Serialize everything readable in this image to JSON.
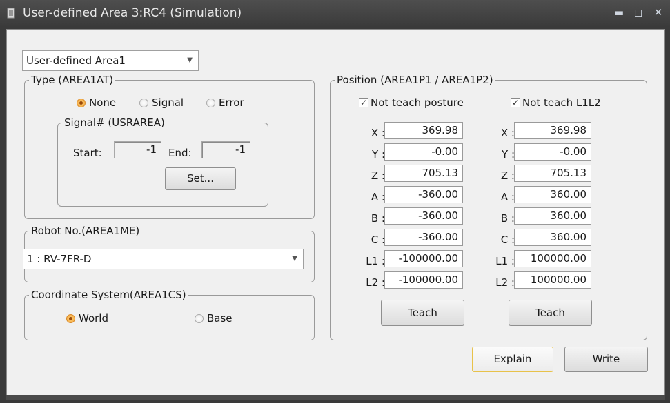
{
  "window": {
    "title": "User-defined Area 3:RC4  (Simulation)",
    "controls": {
      "minimize": "▬",
      "maximize": "◻",
      "close": "✕"
    }
  },
  "area_select": {
    "value": "User-defined Area1"
  },
  "type_group": {
    "legend": "Type (AREA1AT)",
    "options": [
      {
        "label": "None",
        "selected": true
      },
      {
        "label": "Signal",
        "selected": false
      },
      {
        "label": "Error",
        "selected": false
      }
    ]
  },
  "signal_group": {
    "legend": "Signal# (USRAREA)",
    "start_label": "Start:",
    "start_value": "-1",
    "end_label": "End:",
    "end_value": "-1",
    "set_button": "Set..."
  },
  "robot_group": {
    "legend": "Robot No.(AREA1ME)",
    "value": "1 : RV-7FR-D"
  },
  "coord_group": {
    "legend": "Coordinate System(AREA1CS)",
    "options": [
      {
        "label": "World",
        "selected": true
      },
      {
        "label": "Base",
        "selected": false
      }
    ]
  },
  "position_group": {
    "legend": "Position (AREA1P1 / AREA1P2)",
    "check_posture": {
      "label": "Not teach posture",
      "checked": true
    },
    "check_l1l2": {
      "label": "Not teach L1L2",
      "checked": true
    },
    "p1": {
      "rows": [
        {
          "label": "X :",
          "value": "369.98"
        },
        {
          "label": "Y :",
          "value": "-0.00"
        },
        {
          "label": "Z :",
          "value": "705.13"
        },
        {
          "label": "A :",
          "value": "-360.00"
        },
        {
          "label": "B :",
          "value": "-360.00"
        },
        {
          "label": "C :",
          "value": "-360.00"
        },
        {
          "label": "L1 :",
          "value": "-100000.00"
        },
        {
          "label": "L2 :",
          "value": "-100000.00"
        }
      ],
      "teach_button": "Teach"
    },
    "p2": {
      "rows": [
        {
          "label": "X :",
          "value": "369.98"
        },
        {
          "label": "Y :",
          "value": "-0.00"
        },
        {
          "label": "Z :",
          "value": "705.13"
        },
        {
          "label": "A :",
          "value": "360.00"
        },
        {
          "label": "B :",
          "value": "360.00"
        },
        {
          "label": "C :",
          "value": "360.00"
        },
        {
          "label": "L1 :",
          "value": "100000.00"
        },
        {
          "label": "L2 :",
          "value": "100000.00"
        }
      ],
      "teach_button": "Teach"
    }
  },
  "footer": {
    "explain_button": "Explain",
    "write_button": "Write"
  },
  "colors": {
    "radio_selected": "#f2a43a",
    "titlebar": "#3b3b3b",
    "dialog_bg": "#f0f0f0",
    "focus_border": "#e8c24a"
  }
}
